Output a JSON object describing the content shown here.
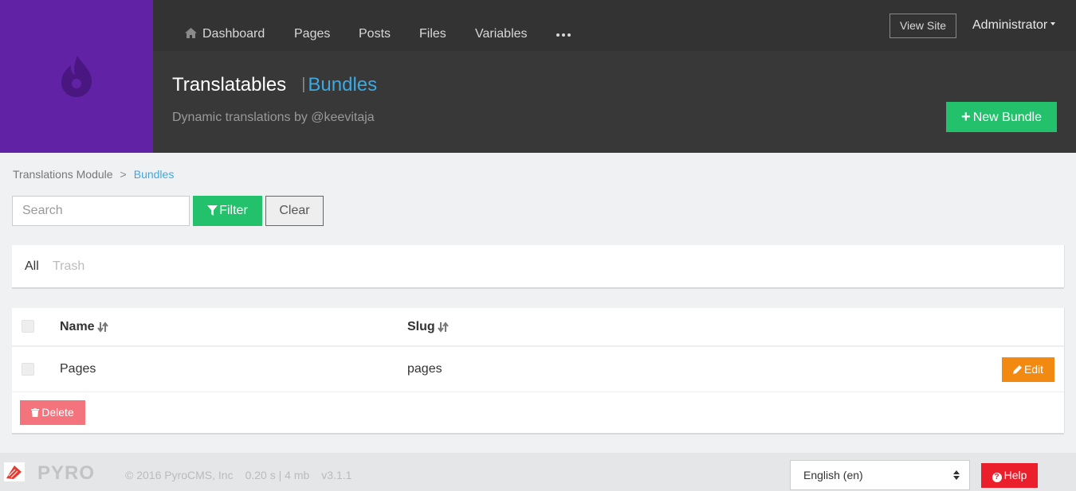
{
  "brand": {
    "logo_icon": "pyro-flame-icon",
    "color": "#6222a5"
  },
  "topnav": {
    "items": [
      "Dashboard",
      "Pages",
      "Posts",
      "Files",
      "Variables"
    ],
    "home_icon": "home-icon",
    "more_icon": "ellipsis-icon",
    "view_site": "View Site",
    "user": "Administrator"
  },
  "header": {
    "title": "Translatables",
    "section": "Bundles",
    "subtitle": "Dynamic translations by @keevitaja",
    "new_button": "New Bundle"
  },
  "breadcrumb": {
    "items": [
      "Translations Module",
      "Bundles"
    ],
    "separator": ">"
  },
  "filters": {
    "search_placeholder": "Search",
    "filter_label": "Filter",
    "clear_label": "Clear"
  },
  "tabs": [
    "All",
    "Trash"
  ],
  "table": {
    "columns": [
      "Name",
      "Slug"
    ],
    "rows": [
      {
        "name": "Pages",
        "slug": "pages",
        "action": "Edit"
      }
    ],
    "delete_label": "Delete"
  },
  "footer": {
    "brand": "PYRO",
    "copyright": "© 2016 PyroCMS, Inc",
    "stats": "0.20 s | 4 mb",
    "version": "v3.1.1",
    "language": "English (en)",
    "help": "Help"
  },
  "colors": {
    "accent_green": "#23c16b",
    "link_blue": "#3ea8e0",
    "edit_orange": "#f28a12",
    "delete_red": "#f3747c",
    "help_red": "#ea1f2b"
  }
}
